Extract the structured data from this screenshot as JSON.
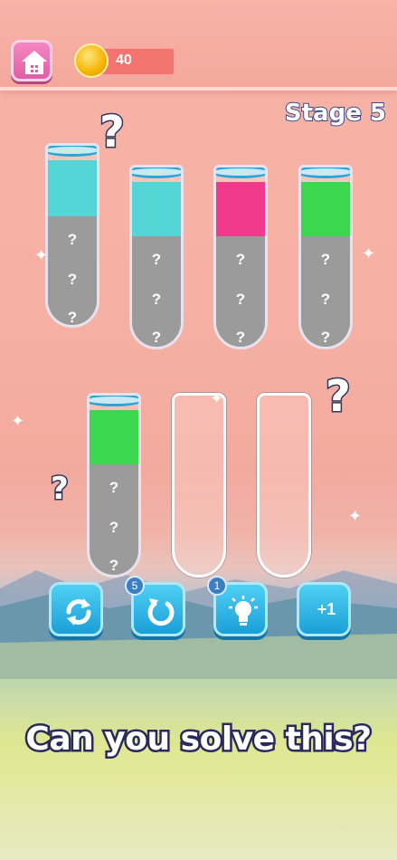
{
  "header": {
    "coins": "40"
  },
  "stage_label": "Stage 5",
  "tubes": [
    {
      "color": "#54d5d6",
      "questions": [
        "?",
        "?",
        "?"
      ]
    },
    {
      "color": "#54d5d6",
      "questions": [
        "?",
        "?",
        "?"
      ]
    },
    {
      "color": "#f23a8c",
      "questions": [
        "?",
        "?",
        "?"
      ]
    },
    {
      "color": "#3bd84f",
      "questions": [
        "?",
        "?",
        "?"
      ]
    },
    {
      "color": "#3bd84f",
      "questions": [
        "?",
        "?",
        "?"
      ]
    },
    {
      "color": "",
      "questions": []
    },
    {
      "color": "",
      "questions": []
    }
  ],
  "hint_marks": [
    "?",
    "?",
    "?"
  ],
  "tools": {
    "undo_count": "5",
    "hint_count": "1",
    "add_tube_label": "+1"
  },
  "caption": "Can you solve this?",
  "icons": [
    "home-icon",
    "coin-icon",
    "restart-icon",
    "undo-icon",
    "lightbulb-icon",
    "test-tube-icon"
  ]
}
